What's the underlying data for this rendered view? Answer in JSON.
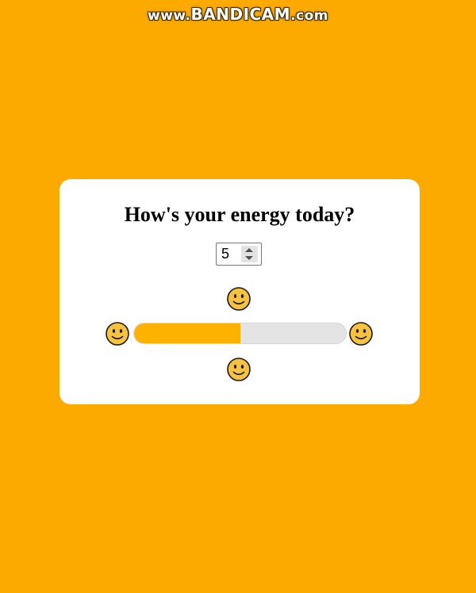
{
  "watermark": {
    "prefix": "www.",
    "brand": "BANDICAM",
    "suffix": ".com"
  },
  "card": {
    "title": "How's your energy today?",
    "energy_input": {
      "value": "5",
      "min_max_hint": ""
    },
    "energy_bar": {
      "value": 5,
      "max": 10,
      "fill_color": "#FDB100",
      "track_color": "#E4E4E4"
    },
    "emoji_icon": "slightly-smiling-face-icon"
  },
  "colors": {
    "background": "#FDAA00",
    "card": "#FFFFFF",
    "emoji_face": "#F7C240"
  }
}
